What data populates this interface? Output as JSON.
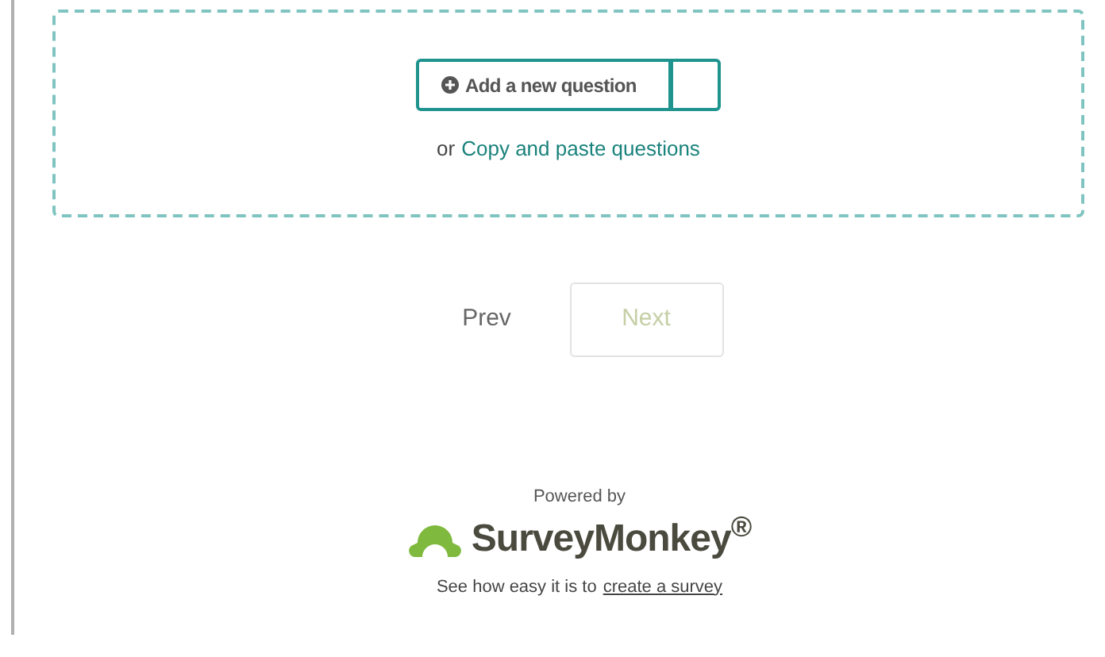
{
  "question_area": {
    "add_button": "Add a new question",
    "link_prefix": "or",
    "link": "Copy and paste questions"
  },
  "pager": {
    "prev": {
      "label": "Prev",
      "disabled": false
    },
    "next": {
      "label": "Next",
      "disabled": true
    }
  },
  "footer": {
    "powered_by": "Powered by",
    "logo": "SurveyMonkey$^{®}$",
    "tagline": "See how easy it is to",
    "tagline_link": "create a survey"
  }
}
